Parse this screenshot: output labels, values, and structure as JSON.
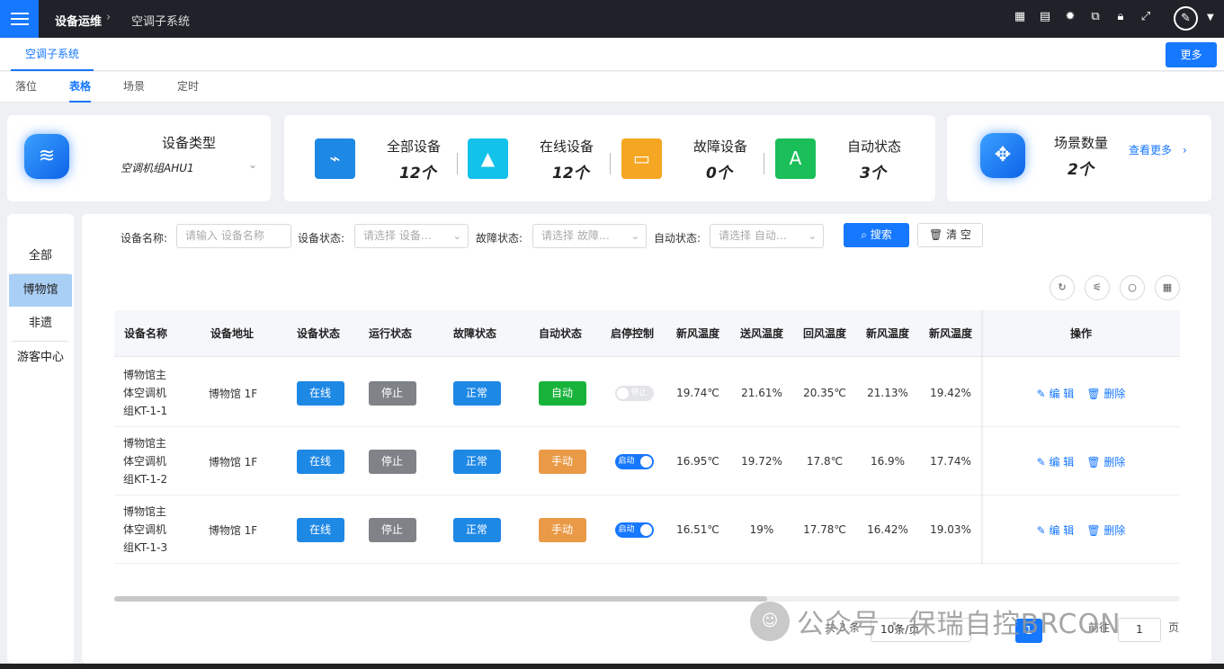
{
  "topbar": {
    "breadcrumb_root": "设备运维",
    "breadcrumb_sep": "›",
    "breadcrumb_current": "空调子系统",
    "icons": [
      "grid-icon",
      "chart-icon",
      "gear-icon",
      "translate-icon",
      "lock-icon",
      "fullscreen-icon"
    ],
    "avatar_icon": "pen-icon"
  },
  "tabs": {
    "main": "空调子系统",
    "more_label": "更多"
  },
  "subtabs": [
    {
      "label": "落位",
      "active": false
    },
    {
      "label": "表格",
      "active": true
    },
    {
      "label": "场景",
      "active": false
    },
    {
      "label": "定时",
      "active": false
    }
  ],
  "device_type": {
    "title": "设备类型",
    "value": "空调机组AHU1"
  },
  "stats": [
    {
      "label": "全部设备",
      "value": "12个",
      "color": "#1e88e5",
      "icon": "router-icon"
    },
    {
      "label": "在线设备",
      "value": "12个",
      "color": "#12c2e9",
      "icon": "rocket-icon"
    },
    {
      "label": "故障设备",
      "value": "0个",
      "color": "#f5a623",
      "icon": "device-icon"
    },
    {
      "label": "自动状态",
      "value": "3个",
      "color": "#1bbf5a",
      "icon": "auto-icon"
    }
  ],
  "scenes": {
    "title": "场景数量",
    "value": "2个",
    "see_more": "查看更多"
  },
  "left_menu": [
    {
      "label": "全部",
      "active": false
    },
    {
      "label": "博物馆",
      "active": true
    },
    {
      "label": "非遗",
      "active": false
    },
    {
      "label": "游客中心",
      "active": false
    }
  ],
  "filters": {
    "name_label": "设备名称:",
    "name_placeholder": "请输入 设备名称",
    "status_label": "设备状态:",
    "status_placeholder": "请选择 设备…",
    "fault_label": "故障状态:",
    "fault_placeholder": "请选择 故障…",
    "auto_label": "自动状态:",
    "auto_placeholder": "请选择 自动…",
    "search_label": "搜索",
    "clear_label": "清 空"
  },
  "table": {
    "columns": [
      "设备名称",
      "设备地址",
      "设备状态",
      "运行状态",
      "故障状态",
      "自动状态",
      "启停控制",
      "新风温度",
      "送风温度",
      "回风温度",
      "新风温度",
      "新风温度",
      "操作"
    ],
    "rows": [
      {
        "name_lines": [
          "博物馆主",
          "体空调机",
          "组KT-1-1"
        ],
        "address": "博物馆 1F",
        "device_status": "在线",
        "run_status": "停止",
        "fault_status": "正常",
        "auto_status": "自动",
        "auto_color": "#17b33a",
        "switch_label": "停止",
        "switch_on": false,
        "t1": "19.74℃",
        "t2": "21.61%",
        "t3": "20.35℃",
        "t4": "21.13%",
        "t5": "19.42%",
        "edit": "编 辑",
        "delete": "删除"
      },
      {
        "name_lines": [
          "博物馆主",
          "体空调机",
          "组KT-1-2"
        ],
        "address": "博物馆 1F",
        "device_status": "在线",
        "run_status": "停止",
        "fault_status": "正常",
        "auto_status": "手动",
        "auto_color": "#ea9a47",
        "switch_label": "启动",
        "switch_on": true,
        "t1": "16.95℃",
        "t2": "19.72%",
        "t3": "17.8℃",
        "t4": "16.9%",
        "t5": "17.74%",
        "edit": "编 辑",
        "delete": "删除"
      },
      {
        "name_lines": [
          "博物馆主",
          "体空调机",
          "组KT-1-3"
        ],
        "address": "博物馆 1F",
        "device_status": "在线",
        "run_status": "停止",
        "fault_status": "正常",
        "auto_status": "手动",
        "auto_color": "#ea9a47",
        "switch_label": "启动",
        "switch_on": true,
        "t1": "16.51℃",
        "t2": "19%",
        "t3": "17.78℃",
        "t4": "16.42%",
        "t5": "19.03%",
        "edit": "编 辑",
        "delete": "删除"
      }
    ]
  },
  "pagination": {
    "total": "共 3 条",
    "page_size": "10条/页",
    "current_page": "1",
    "goto_label": "前往",
    "goto_value": "1",
    "page_unit": "页"
  },
  "watermark": {
    "text": "公众号 · 保瑞自控BRCON"
  }
}
